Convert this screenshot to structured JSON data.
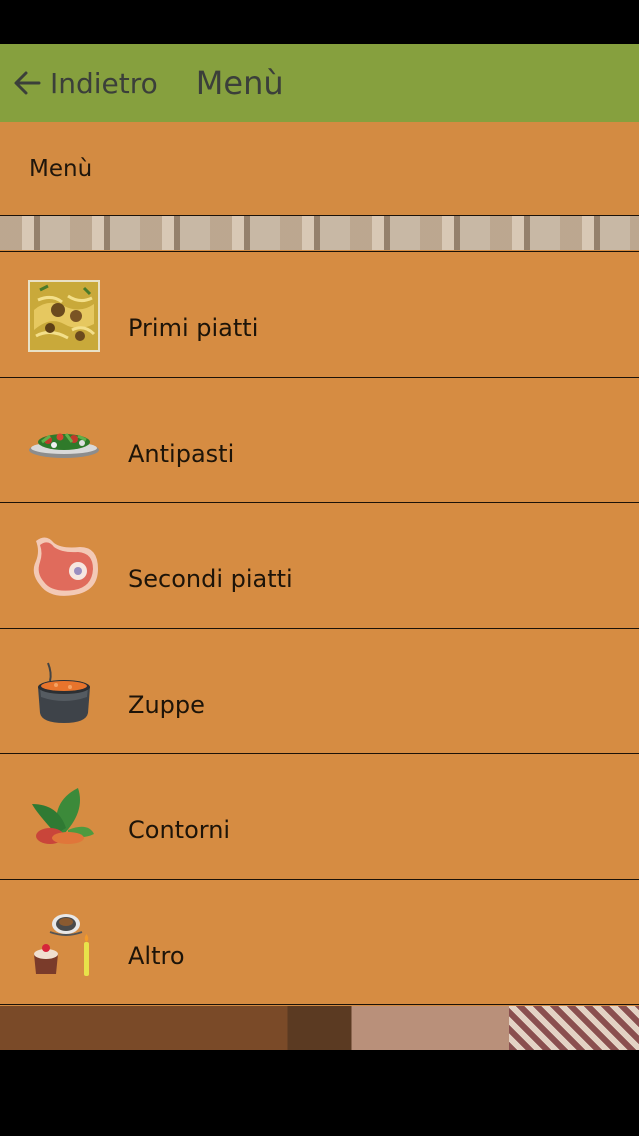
{
  "toolbar": {
    "back_label": "Indietro",
    "title": "Menù",
    "color": "#86a03e"
  },
  "header": {
    "label": "Menù"
  },
  "menu": {
    "items": [
      {
        "label": "Primi piatti",
        "icon": "pasta-dish-icon"
      },
      {
        "label": "Antipasti",
        "icon": "salad-plate-icon"
      },
      {
        "label": "Secondi piatti",
        "icon": "steak-icon"
      },
      {
        "label": "Zuppe",
        "icon": "soup-pot-icon"
      },
      {
        "label": "Contorni",
        "icon": "vegetables-icon"
      },
      {
        "label": "Altro",
        "icon": "dessert-coffee-icon"
      }
    ]
  },
  "colors": {
    "background": "#d38b42",
    "text": "#1f160c"
  }
}
